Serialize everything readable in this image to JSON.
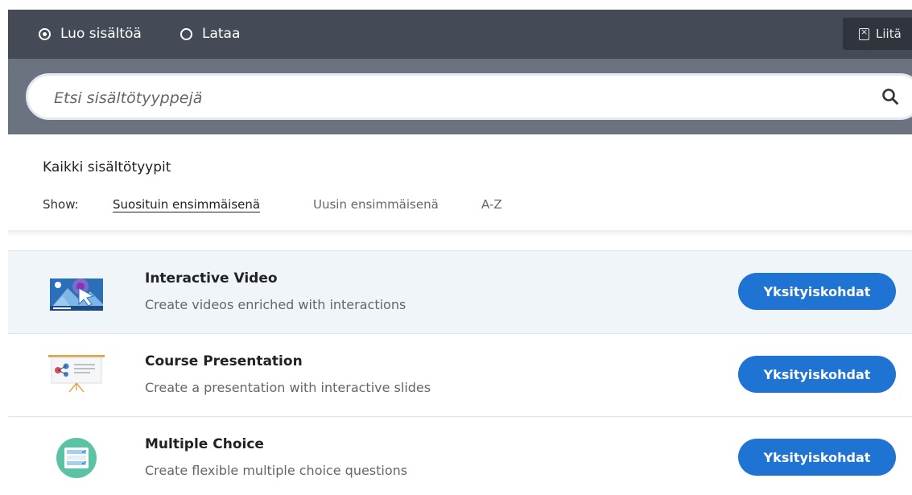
{
  "header": {
    "mode_options": [
      {
        "label": "Luo sisältöä",
        "selected": true
      },
      {
        "label": "Lataa",
        "selected": false
      }
    ],
    "paste_label": "Liitä"
  },
  "search": {
    "placeholder": "Etsi sisältötyyppejä"
  },
  "filter": {
    "title": "Kaikki sisältötyypit",
    "show_label": "Show:",
    "sort_options": [
      {
        "label": "Suosituin ensimmäisenä",
        "active": true
      },
      {
        "label": "Uusin ensimmäisenä",
        "active": false
      },
      {
        "label": "A-Z",
        "active": false
      }
    ]
  },
  "content_types": [
    {
      "title": "Interactive Video",
      "description": "Create videos enriched with interactions",
      "button_label": "Yksityiskohdat",
      "icon": "interactive-video-icon"
    },
    {
      "title": "Course Presentation",
      "description": "Create a presentation with interactive slides",
      "button_label": "Yksityiskohdat",
      "icon": "course-presentation-icon"
    },
    {
      "title": "Multiple Choice",
      "description": "Create flexible multiple choice questions",
      "button_label": "Yksityiskohdat",
      "icon": "multiple-choice-icon"
    }
  ],
  "colors": {
    "header_bg": "#444b57",
    "search_band_bg": "#6b7380",
    "primary_button": "#1f74d3"
  }
}
